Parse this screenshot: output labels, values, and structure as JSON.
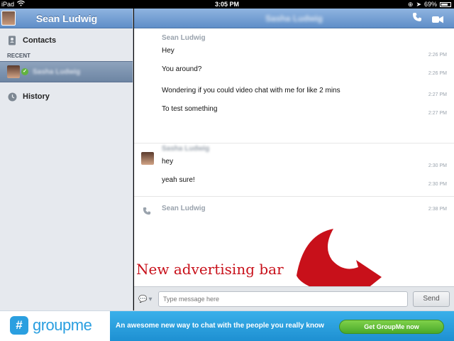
{
  "status_bar": {
    "device": "iPad",
    "time": "3:05 PM",
    "battery": "69%"
  },
  "sidebar": {
    "header_title": "Sean Ludwig",
    "contacts_label": "Contacts",
    "recent_label": "RECENT",
    "recent_contact": "Sasha Ludwig",
    "history_label": "History"
  },
  "chat": {
    "header_title": "Sasha Ludwig",
    "groups": [
      {
        "sender": "Sean Ludwig",
        "messages": [
          {
            "text": "Hey",
            "time": "2:26 PM"
          },
          {
            "text": "You around?",
            "time": "2:26 PM"
          },
          {
            "text": "Wondering if you could video chat with me for like 2 mins",
            "time": "2:27 PM"
          },
          {
            "text": "To test something",
            "time": "2:27 PM"
          }
        ]
      },
      {
        "sender": "Sasha Ludwig",
        "messages": [
          {
            "text": "hey",
            "time": "2:30 PM"
          },
          {
            "text": "yeah sure!",
            "time": "2:30 PM"
          }
        ]
      },
      {
        "sender": "Sean Ludwig",
        "time": "2:38 PM"
      }
    ]
  },
  "annotation": {
    "text": "New advertising bar",
    "color": "#c8101a"
  },
  "composer": {
    "placeholder": "Type message here",
    "send_label": "Send"
  },
  "ad": {
    "logo_text": "groupme",
    "logo_badge": "#",
    "tagline": "An awesome new way to chat with the people you really know",
    "cta_label": "Get GroupMe now",
    "brand_color": "#2a9fe0",
    "cta_color": "#5bb832"
  }
}
